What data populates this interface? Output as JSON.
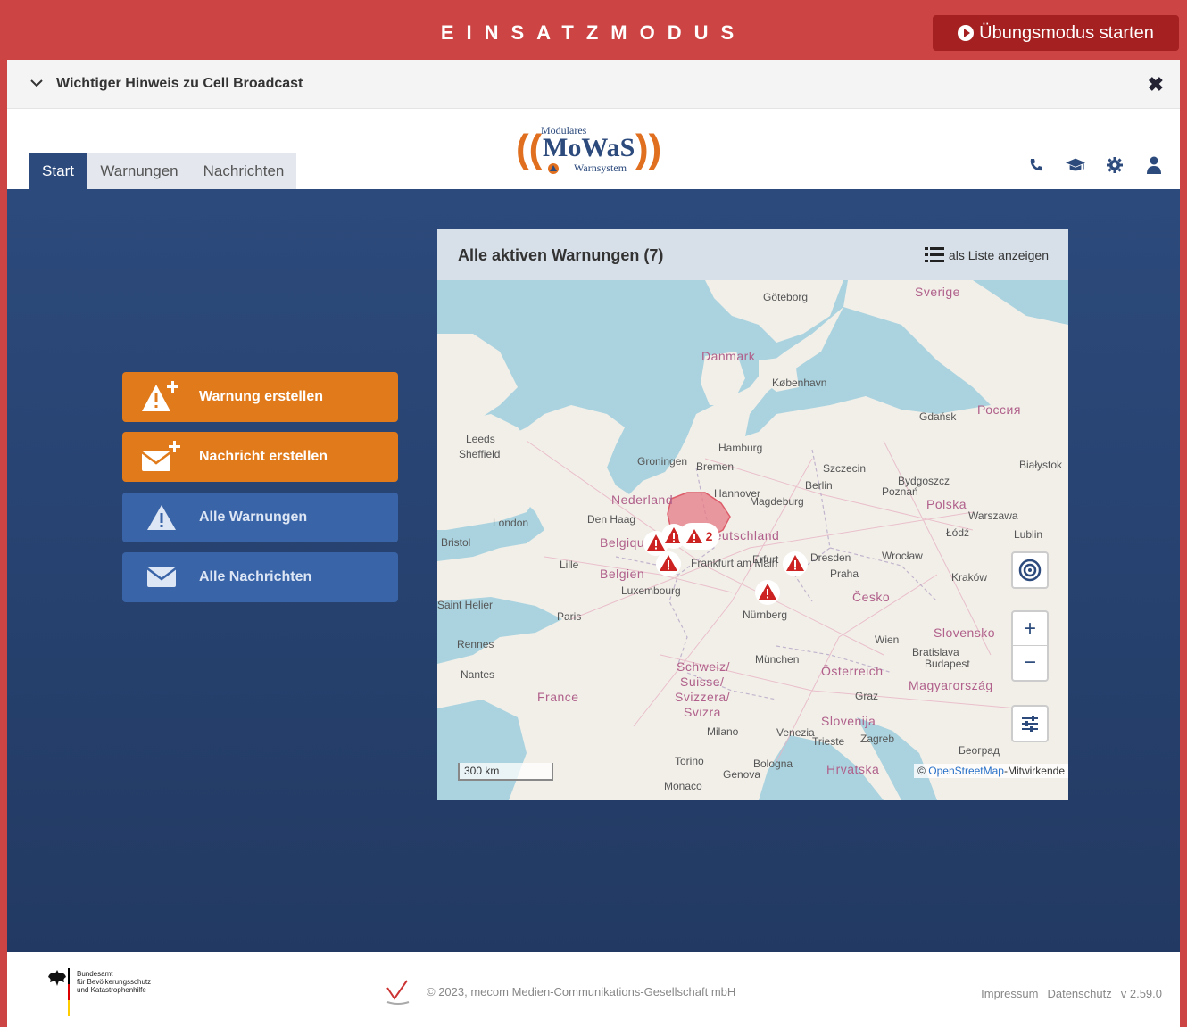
{
  "mode": {
    "title": "EINSATZMODUS",
    "practice_button": "Übungsmodus starten"
  },
  "notice": {
    "text": "Wichtiger Hinweis zu Cell Broadcast"
  },
  "logo": {
    "top": "Modulares",
    "main": "MoWaS",
    "bottom": "Warnsystem"
  },
  "tabs": [
    {
      "label": "Start"
    },
    {
      "label": "Warnungen"
    },
    {
      "label": "Nachrichten"
    }
  ],
  "header_icons": [
    "phone-icon",
    "graduation-cap-icon",
    "gear-icon",
    "user-icon"
  ],
  "actions": [
    {
      "label": "Warnung erstellen",
      "icon": "warning-add-icon"
    },
    {
      "label": "Nachricht erstellen",
      "icon": "envelope-add-icon"
    },
    {
      "label": "Alle Warnungen",
      "icon": "warning-icon"
    },
    {
      "label": "Alle Nachrichten",
      "icon": "envelope-icon"
    }
  ],
  "map": {
    "title": "Alle aktiven Warnungen (7)",
    "list_link": "als Liste anzeigen",
    "scale": "300 km",
    "attribution_prefix": "© ",
    "attribution_link": "OpenStreetMap",
    "attribution_suffix": "-Mitwirkende",
    "cluster_count": "2",
    "labels": {
      "goteborg": "Göteborg",
      "sverige": "Sverige",
      "danmark": "Danmark",
      "kobenhavn": "København",
      "gdansk": "Gdańsk",
      "rossiya": "Россия",
      "leeds": "Leeds",
      "sheffield": "Sheffield",
      "hamburg": "Hamburg",
      "groningen": "Groningen",
      "bremen": "Bremen",
      "szczecin": "Szczecin",
      "bialystok": "Białystok",
      "berlin": "Berlin",
      "bydgoszcz": "Bydgoszcz",
      "poznan": "Poznań",
      "nederland": "Nederland",
      "hannover": "Hannover",
      "magdeburg": "Magdeburg",
      "polska": "Polska",
      "warszawa": "Warszawa",
      "london": "London",
      "denhaag": "Den Haag",
      "lodz": "Łódź",
      "lublin": "Lublin",
      "bristol": "Bristol",
      "deutschland": "Deutschland",
      "wroclaw": "Wrocław",
      "lille": "Lille",
      "belgique": "Belgique",
      "belgien": "Belgien",
      "frankfurt": "Frankfurt am Main",
      "erfurt": "Erfurt",
      "dresden": "Dresden",
      "praha": "Praha",
      "krakow": "Kraków",
      "luxembourg": "Luxembourg",
      "cesko": "Česko",
      "sainthelier": "Saint Helier",
      "paris": "Paris",
      "nurnberg": "Nürnberg",
      "rennes": "Rennes",
      "wien": "Wien",
      "slovensko": "Slovensko",
      "bratislava": "Bratislava",
      "budapest": "Budapest",
      "munchen": "München",
      "nantes": "Nantes",
      "schweiz": "Schweiz/",
      "suisse": "Suisse/",
      "svizzera": "Svizzera/",
      "svizra": "Svizra",
      "osterreich": "Österreich",
      "france": "France",
      "magyarorszag": "Magyarország",
      "graz": "Graz",
      "slovenija": "Slovenija",
      "milano": "Milano",
      "venezia": "Venezia",
      "trieste": "Trieste",
      "zagreb": "Zagreb",
      "beograd": "Београд",
      "torino": "Torino",
      "bologna": "Bologna",
      "hrvatska": "Hrvatska",
      "genova": "Genova",
      "monaco": "Monaco"
    }
  },
  "footer": {
    "bbk_line1": "Bundesamt",
    "bbk_line2": "für Bevölkerungsschutz",
    "bbk_line3": "und Katastrophenhilfe",
    "copyright": "© 2023, mecom Medien-Communikations-Gesellschaft mbH",
    "impressum": "Impressum",
    "datenschutz": "Datenschutz",
    "version": "v 2.59.0"
  },
  "colors": {
    "mode_bar": "#cc4444",
    "primary": "#2c4a7c",
    "orange": "#e07a1a",
    "blue_button": "#3a64a8",
    "warning_red": "#cc2222"
  }
}
